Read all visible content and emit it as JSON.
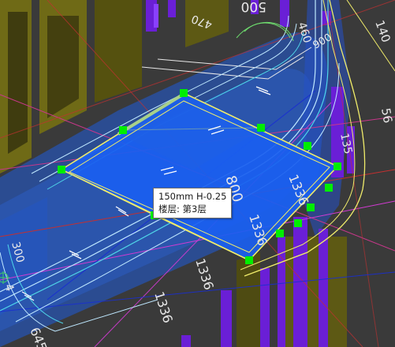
{
  "canvas": {
    "background": "#3a3a3a",
    "colors": {
      "blue_fill": "#1f5bd8",
      "selected_slab": "#1a5ff0",
      "selection_outline": "#f0ec6a",
      "grip": "#00ee00",
      "purple_column": "#6a1fd6",
      "magenta_line": "#d23bd2",
      "olive_panel": "#6f6a16"
    },
    "dimensions": {
      "d_500": "500",
      "d_470": "470",
      "d_460": "460",
      "d_900": "900",
      "d_140_top": "140",
      "d_56": "56",
      "d_135": "135",
      "d_800": "800",
      "d_1336_a": "1336",
      "d_1336_b": "1336",
      "d_1336_c": "1336",
      "d_1336_d": "1336",
      "d_300": "300",
      "d_645": "645",
      "d_4": "4"
    }
  },
  "tooltip": {
    "line1": "150mm H-0.25",
    "line2": "楼层: 第3层"
  }
}
